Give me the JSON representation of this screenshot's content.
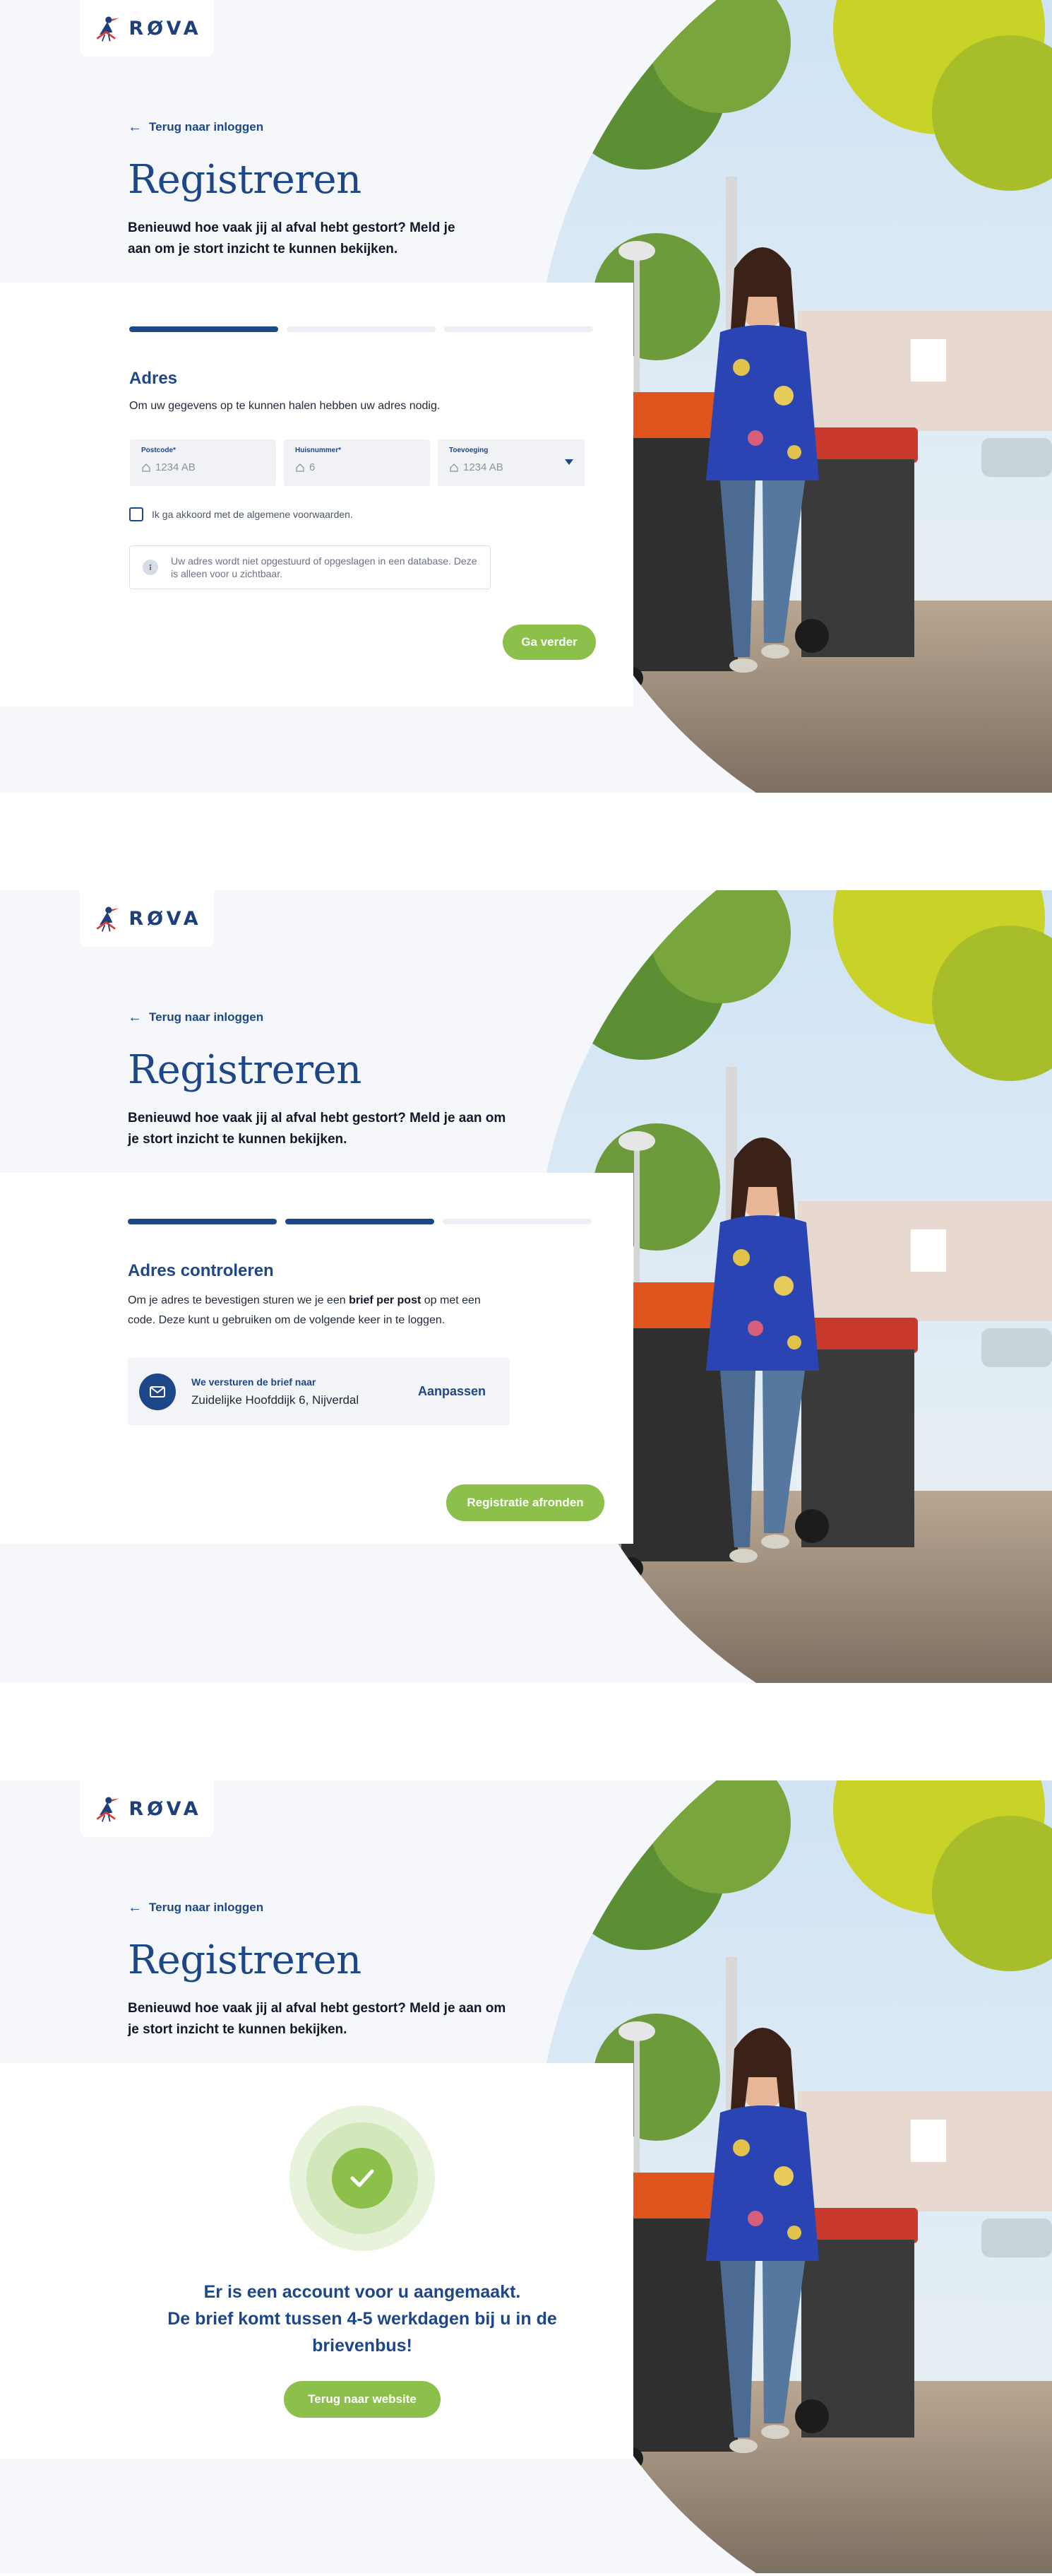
{
  "brand": {
    "name": "RØVA",
    "primary_color": "#1d4788",
    "accent_color": "#8cc04b"
  },
  "common": {
    "back_link": "Terug naar inloggen",
    "title": "Registreren",
    "subtitle": "Benieuwd hoe vaak jij al afval hebt gestort? Meld je aan om je stort inzicht te kunnen bekijken."
  },
  "step1": {
    "progress": {
      "active_steps": 1,
      "total_steps": 3
    },
    "section_title": "Adres",
    "section_desc": "Om uw gegevens op te kunnen halen hebben uw adres nodig.",
    "fields": [
      {
        "label": "Postcode*",
        "placeholder": "1234 AB"
      },
      {
        "label": "Huisnummer*",
        "placeholder": "6"
      },
      {
        "label": "Toevoeging",
        "placeholder": "1234 AB"
      }
    ],
    "agree_label": "Ik ga akkoord met de algemene voorwaarden.",
    "note": "Uw adres wordt niet opgestuurd of opgeslagen in een database. Deze is alleen voor u zichtbaar.",
    "button": "Ga verder"
  },
  "step2": {
    "progress": {
      "active_steps": 2,
      "total_steps": 3
    },
    "section_title": "Adres controleren",
    "desc_before": "Om je adres te bevestigen sturen we je een ",
    "desc_bold": "brief per post",
    "desc_after": " op met een code. Deze kunt u gebruiken om de volgende keer in te loggen.",
    "address_label": "We versturen de brief naar",
    "address_value": "Zuidelijke Hoofddijk 6, Nijverdal",
    "edit_link": "Aanpassen",
    "button": "Registratie afronden"
  },
  "step3": {
    "message_line1": "Er is een account voor u aangemaakt.",
    "message_line2": "De brief komt tussen 4-5 werkdagen bij u in de brievenbus!",
    "button": "Terug naar website"
  }
}
